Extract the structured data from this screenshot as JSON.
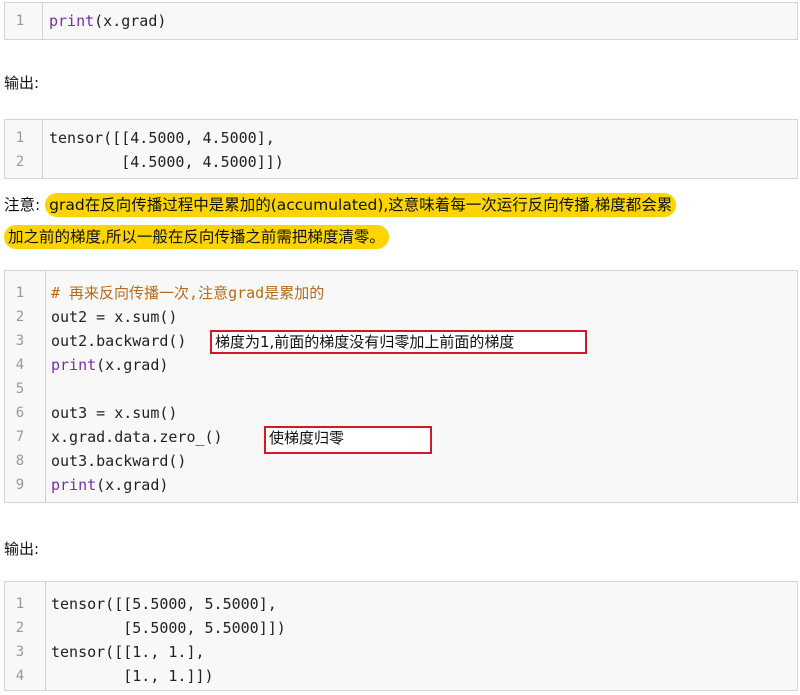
{
  "block1": {
    "lines": [
      {
        "num": "1",
        "fn": "print",
        "rest": "(x.grad)"
      }
    ]
  },
  "output_label_1": "输出:",
  "block2": {
    "lines": [
      {
        "num": "1",
        "text": "tensor([[4.5000, 4.5000],"
      },
      {
        "num": "2",
        "text": "        [4.5000, 4.5000]])"
      }
    ]
  },
  "note": {
    "prefix": "注意:",
    "highlight_1": "grad在反向传播过程中是累加的(accumulated),这意味着每一次运行反向传播,梯度都会累",
    "highlight_2": "加之前的梯度,所以一般在反向传播之前需把梯度清零。"
  },
  "block3": {
    "lines": [
      {
        "num": "1",
        "comment": "# 再来反向传播一次,注意grad是累加的"
      },
      {
        "num": "2",
        "text": "out2 = x.sum()"
      },
      {
        "num": "3",
        "text": "out2.backward()"
      },
      {
        "num": "4",
        "fn": "print",
        "rest": "(x.grad)"
      },
      {
        "num": "5",
        "text": ""
      },
      {
        "num": "6",
        "text": "out3 = x.sum()"
      },
      {
        "num": "7",
        "text": "x.grad.data.zero_()"
      },
      {
        "num": "8",
        "text": "out3.backward()"
      },
      {
        "num": "9",
        "fn": "print",
        "rest": "(x.grad)"
      }
    ]
  },
  "annotations": {
    "backward_note": "梯度为1,前面的梯度没有归零加上前面的梯度",
    "zero_note": "使梯度归零"
  },
  "output_label_2": "输出:",
  "block4": {
    "lines": [
      {
        "num": "1",
        "text": "tensor([[5.5000, 5.5000],"
      },
      {
        "num": "2",
        "text": "        [5.5000, 5.5000]])"
      },
      {
        "num": "3",
        "text": "tensor([[1., 1.],"
      },
      {
        "num": "4",
        "text": "        [1., 1.]])"
      }
    ]
  }
}
